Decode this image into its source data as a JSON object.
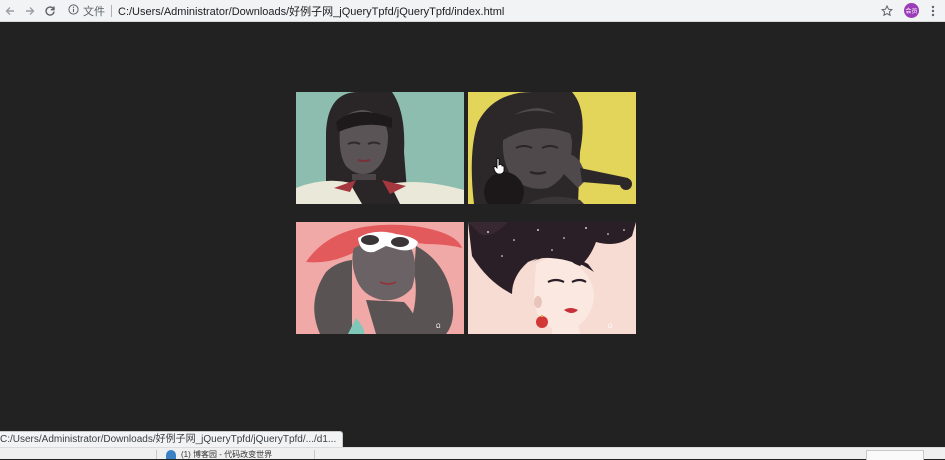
{
  "browser": {
    "scheme_label": "文件",
    "url": "C:/Users/Administrator/Downloads/好例子网_jQueryTpfd/jQueryTpfd/index.html",
    "profile_label": "会员",
    "icons": [
      "back-icon",
      "forward-icon",
      "reload-icon",
      "info-icon",
      "star-icon",
      "menu-icon"
    ]
  },
  "gallery": {
    "tiles": [
      {
        "subject": "woman-with-bangs",
        "background": "#8cbdaf"
      },
      {
        "subject": "woman-with-phone",
        "background": "#e3d45a"
      },
      {
        "subject": "woman-with-sunhat",
        "background": "#f0a9a6"
      },
      {
        "subject": "woman-with-starry-hair",
        "background": "#f6dcd3"
      }
    ]
  },
  "status_bar": {
    "text": "C:/Users/Administrator/Downloads/好例子网_jQueryTpfd/jQueryTpfd/.../d1..."
  },
  "taskbar": {
    "item_label": "(1) 博客园 - 代码改变世界"
  },
  "colors": {
    "page_background": "#222222",
    "toolbar_background": "#f1f3f4",
    "avatar": "#9b3db8"
  }
}
